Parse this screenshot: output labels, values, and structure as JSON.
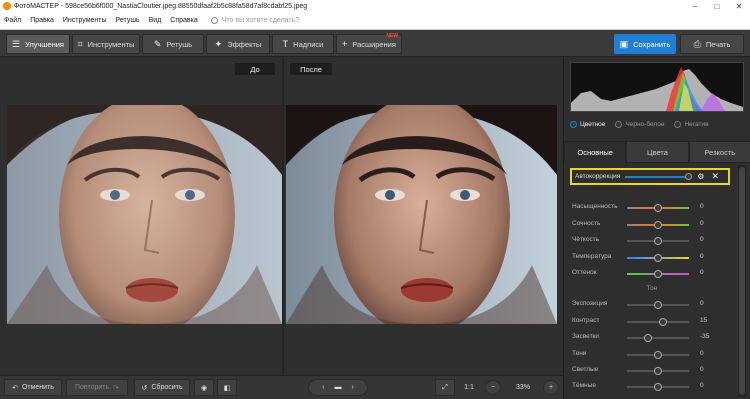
{
  "titlebar": {
    "title": "ФотоМАСТЕР - 598ce56b6f000_NastiaCloutier.jpeg.88550dfaaf2b5c88fa58d7af8cdabf25.jpeg",
    "min": "–",
    "max": "□",
    "close": "✕"
  },
  "menu": {
    "items": [
      "Файл",
      "Правка",
      "Инструменты",
      "Ретушь",
      "Вид",
      "Справка"
    ],
    "search_placeholder": "Что вы хотите сделать?"
  },
  "toolbar": {
    "tabs": [
      {
        "label": "Улучшения",
        "icon": "sliders-icon"
      },
      {
        "label": "Инструменты",
        "icon": "crop-icon"
      },
      {
        "label": "Ретушь",
        "icon": "brush-icon"
      },
      {
        "label": "Эффекты",
        "icon": "wand-icon"
      },
      {
        "label": "Надписи",
        "icon": "text-icon"
      },
      {
        "label": "Расширения",
        "icon": "plus-icon",
        "badge": "NEW"
      }
    ],
    "save_label": "Сохранить",
    "print_label": "Печать"
  },
  "canvas": {
    "before_label": "До",
    "after_label": "После"
  },
  "bottom": {
    "undo": "Отменить",
    "redo": "Повторить",
    "reset": "Сбросить",
    "ratio": "1:1",
    "zoom": "33%"
  },
  "panel": {
    "modes": [
      "Цветное",
      "Черно-белое",
      "Негатив"
    ],
    "tabs": [
      "Основные",
      "Цвета",
      "Резкость"
    ],
    "auto_label": "Автокоррекция",
    "section_tone": "Тон",
    "sliders_color": [
      {
        "name": "Насыщенность",
        "value": "0"
      },
      {
        "name": "Сочность",
        "value": "0"
      },
      {
        "name": "Чёткость",
        "value": "0"
      },
      {
        "name": "Температура",
        "value": "0"
      },
      {
        "name": "Оттенок",
        "value": "0"
      }
    ],
    "sliders_tone": [
      {
        "name": "Экспозиция",
        "value": "0"
      },
      {
        "name": "Контраст",
        "value": "15"
      },
      {
        "name": "Засветки",
        "value": "-35"
      },
      {
        "name": "Тени",
        "value": "0"
      },
      {
        "name": "Светлые",
        "value": "0"
      },
      {
        "name": "Тёмные",
        "value": "0"
      }
    ]
  },
  "colors": {
    "accent": "#1f7fd6",
    "highlight": "#e7d91f",
    "badge": "#ff4d30"
  }
}
